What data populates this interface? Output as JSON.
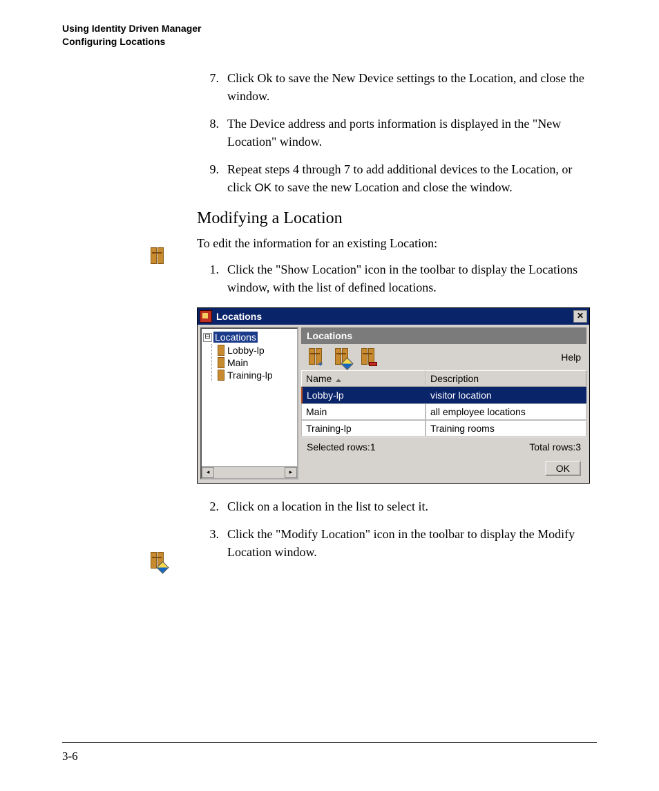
{
  "header": {
    "line1": "Using Identity Driven Manager",
    "line2": "Configuring Locations"
  },
  "steps_top": [
    {
      "n": "7.",
      "t": "Click Ok to save the New Device settings to the Location, and close the window."
    },
    {
      "n": "8.",
      "t": " The Device address and ports information is displayed in the \"New Location\" window."
    },
    {
      "n": "9.",
      "t_pre": "Repeat steps 4 through 7 to add additional devices to the Location, or click ",
      "t_mid": "OK",
      "t_post": " to save the new Location and close the window."
    }
  ],
  "section_title": "Modifying a Location",
  "section_intro": "To edit the information for an existing Location:",
  "steps_a": [
    {
      "n": "1.",
      "t": "Click the \"Show Location\" icon in the toolbar to display the Locations window, with the list of defined locations."
    }
  ],
  "steps_b": [
    {
      "n": "2.",
      "t": "Click on a location in the list to select it."
    },
    {
      "n": "3.",
      "t": "Click the \"Modify Location\" icon in the toolbar to display the Modify Location window."
    }
  ],
  "window": {
    "title": "Locations",
    "close": "✕",
    "tree": {
      "root": "Locations",
      "root_toggle": "⊟",
      "items": [
        "Lobby-lp",
        "Main",
        "Training-lp"
      ],
      "scroll_left": "◂",
      "scroll_right": "▸"
    },
    "panel_header": "Locations",
    "toolbar": {
      "help": "Help"
    },
    "columns": {
      "name": "Name",
      "desc": "Description"
    },
    "rows": [
      {
        "name": "Lobby-lp",
        "desc": "visitor location",
        "selected": true
      },
      {
        "name": "Main",
        "desc": "all employee locations",
        "selected": false
      },
      {
        "name": "Training-lp",
        "desc": "Training rooms",
        "selected": false
      }
    ],
    "status": {
      "left": "Selected rows:1",
      "right": "Total rows:3"
    },
    "ok": "OK"
  },
  "page_number": "3-6"
}
